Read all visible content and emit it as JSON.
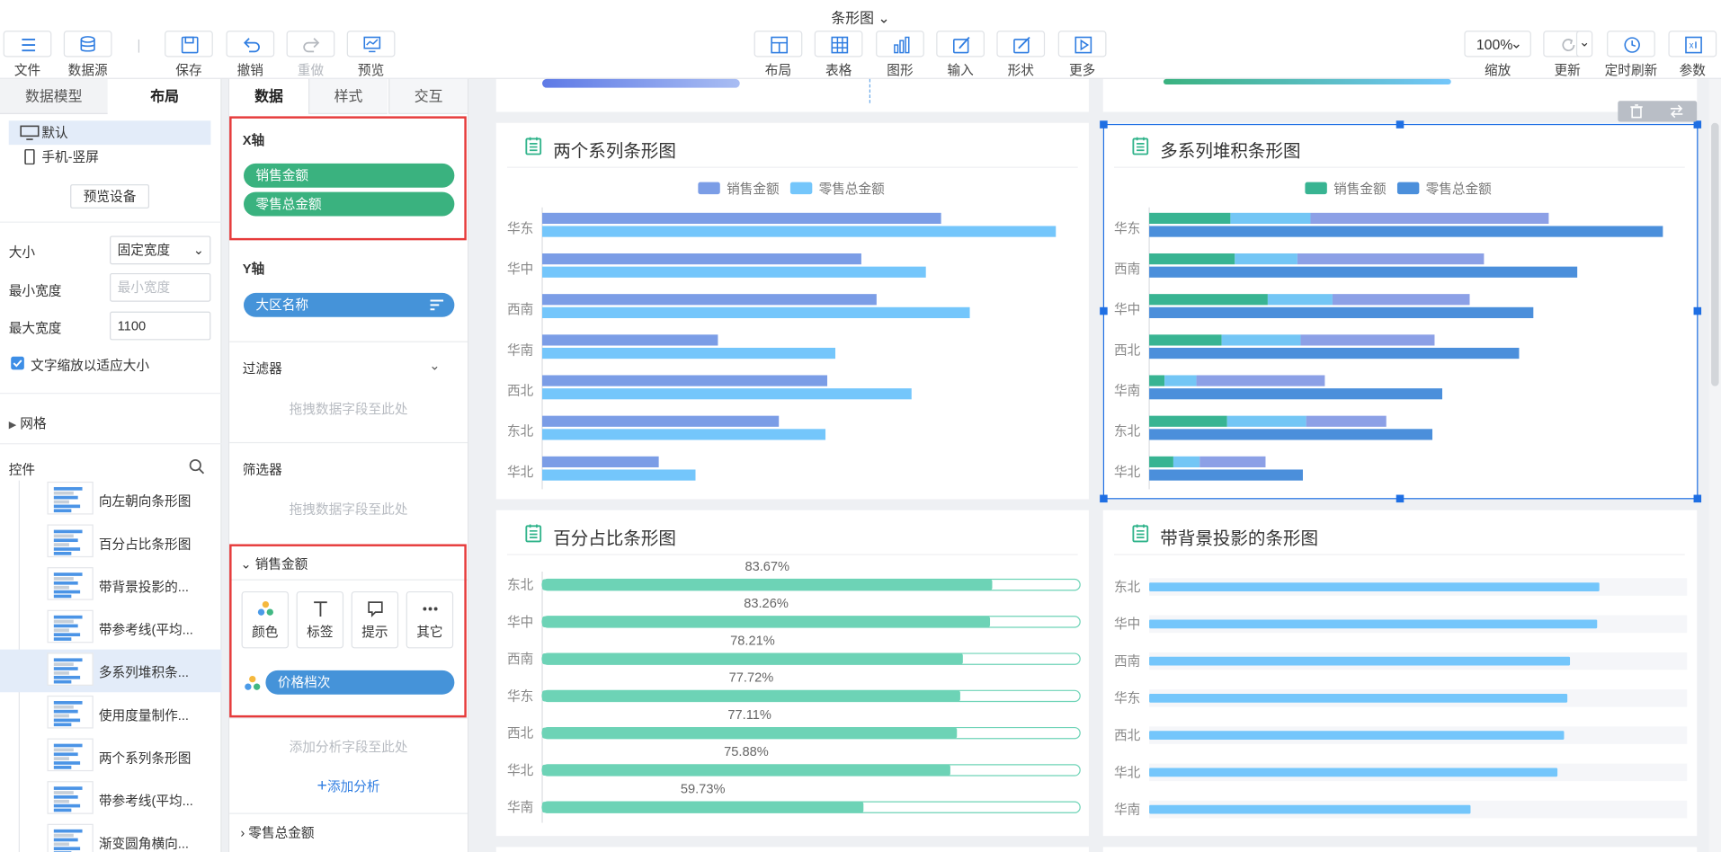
{
  "title": "条形图",
  "toolbar": {
    "left": [
      {
        "label": "文件",
        "icon": "menu-icon"
      },
      {
        "label": "数据源",
        "icon": "database-icon"
      },
      {
        "label": "保存",
        "icon": "save-icon"
      },
      {
        "label": "撤销",
        "icon": "undo-icon"
      },
      {
        "label": "重做",
        "icon": "redo-icon"
      },
      {
        "label": "预览",
        "icon": "preview-icon"
      }
    ],
    "center": [
      {
        "label": "布局",
        "icon": "layout-icon"
      },
      {
        "label": "表格",
        "icon": "table-icon"
      },
      {
        "label": "图形",
        "icon": "chart-icon"
      },
      {
        "label": "输入",
        "icon": "input-icon"
      },
      {
        "label": "形状",
        "icon": "shape-icon"
      },
      {
        "label": "更多",
        "icon": "more-icon"
      }
    ],
    "zoom": "100%",
    "zoom_label": "缩放",
    "right": [
      {
        "label": "更新",
        "icon": "refresh-icon"
      },
      {
        "label": "定时刷新",
        "icon": "clock-icon"
      },
      {
        "label": "参数",
        "icon": "params-icon"
      }
    ]
  },
  "left_panel": {
    "tabs": [
      "数据模型",
      "布局"
    ],
    "devices": [
      "默认",
      "手机-竖屏"
    ],
    "preview_device": "预览设备",
    "size_label": "大小",
    "size_value": "固定宽度",
    "min_width_label": "最小宽度",
    "min_width_placeholder": "最小宽度",
    "max_width_label": "最大宽度",
    "max_width_value": "1100",
    "fit_text": "文字缩放以适应大小",
    "grid": "网格",
    "controls_label": "控件",
    "controls": [
      "向左朝向条形图",
      "百分占比条形图",
      "带背景投影的...",
      "带参考线(平均...",
      "多系列堆积条...",
      "使用度量制作...",
      "两个系列条形图",
      "带参考线(平均...",
      "渐变圆角横向..."
    ],
    "selected_control": 4
  },
  "mid_panel": {
    "tabs": [
      "数据",
      "样式",
      "交互"
    ],
    "x_axis": "X轴",
    "x_fields": [
      "销售金额",
      "零售总金额"
    ],
    "y_axis": "Y轴",
    "y_field": "大区名称",
    "filter": "过滤器",
    "drop_hint": "拖拽数据字段至此处",
    "selector": "筛选器",
    "measure": "销售金额",
    "options": [
      "颜色",
      "标签",
      "提示",
      "其它"
    ],
    "color_field": "价格档次",
    "add_hint": "添加分析字段至此处",
    "add_analysis": "添加分析",
    "measure2": "零售总金额"
  },
  "charts": {
    "two_series": {
      "title": "两个系列条形图",
      "chart_data": {
        "type": "bar",
        "orientation": "horizontal",
        "categories": [
          "华东",
          "华中",
          "西南",
          "华南",
          "西北",
          "东北",
          "华北"
        ],
        "series": [
          {
            "name": "销售金额",
            "values": [
              445,
              356,
              373,
              196,
              318,
              264,
              130
            ]
          },
          {
            "name": "零售总金额",
            "values": [
              573,
              428,
              477,
              327,
              412,
              316,
              171
            ]
          }
        ],
        "xlim": [
          0,
          600
        ],
        "legend": "top-center",
        "colors": [
          "#7b9de6",
          "#74c6fb"
        ]
      }
    },
    "stacked": {
      "title": "多系列堆积条形图",
      "chart_data": {
        "type": "bar",
        "orientation": "horizontal",
        "stacked": true,
        "categories": [
          "华东",
          "西南",
          "华中",
          "西北",
          "华南",
          "东北",
          "华北"
        ],
        "stack_segments": [
          [
            74,
            73,
            217
          ],
          [
            78,
            57,
            170
          ],
          [
            108,
            59,
            125
          ],
          [
            66,
            72,
            122
          ],
          [
            14,
            29,
            117
          ],
          [
            71,
            72,
            73
          ],
          [
            22,
            24,
            60
          ]
        ],
        "series": [
          {
            "name": "销售金额",
            "values": [
              364,
              305,
              292,
              260,
              160,
              216,
              106
            ]
          },
          {
            "name": "零售总金额",
            "values": [
              468,
              390,
              350,
              337,
              267,
              258,
              140
            ]
          }
        ],
        "legend": "top-center",
        "colors": [
          "#38b492",
          "#73c6f5",
          "#8ca0e6",
          "#4b8fdb"
        ]
      }
    },
    "percent": {
      "title": "百分占比条形图",
      "chart_data": {
        "type": "bar",
        "orientation": "horizontal",
        "categories": [
          "东北",
          "华中",
          "西南",
          "华东",
          "西北",
          "华北",
          "华南"
        ],
        "values": [
          83.67,
          83.26,
          78.21,
          77.72,
          77.11,
          75.88,
          59.73
        ],
        "labels": [
          "83.67%",
          "83.26%",
          "78.21%",
          "77.72%",
          "77.11%",
          "75.88%",
          "59.73%"
        ],
        "xlim": [
          0,
          100
        ],
        "colors": [
          "#6dd3b6"
        ]
      }
    },
    "shadow": {
      "title": "带背景投影的条形图",
      "chart_data": {
        "type": "bar",
        "orientation": "horizontal",
        "categories": [
          "东北",
          "华中",
          "西南",
          "华东",
          "西北",
          "华北",
          "华南"
        ],
        "values": [
          83.67,
          83.26,
          78.21,
          77.72,
          77.11,
          75.88,
          59.73
        ],
        "xlim": [
          0,
          100
        ],
        "colors": [
          "#74c6fb",
          "#f5f6f9"
        ]
      }
    }
  }
}
